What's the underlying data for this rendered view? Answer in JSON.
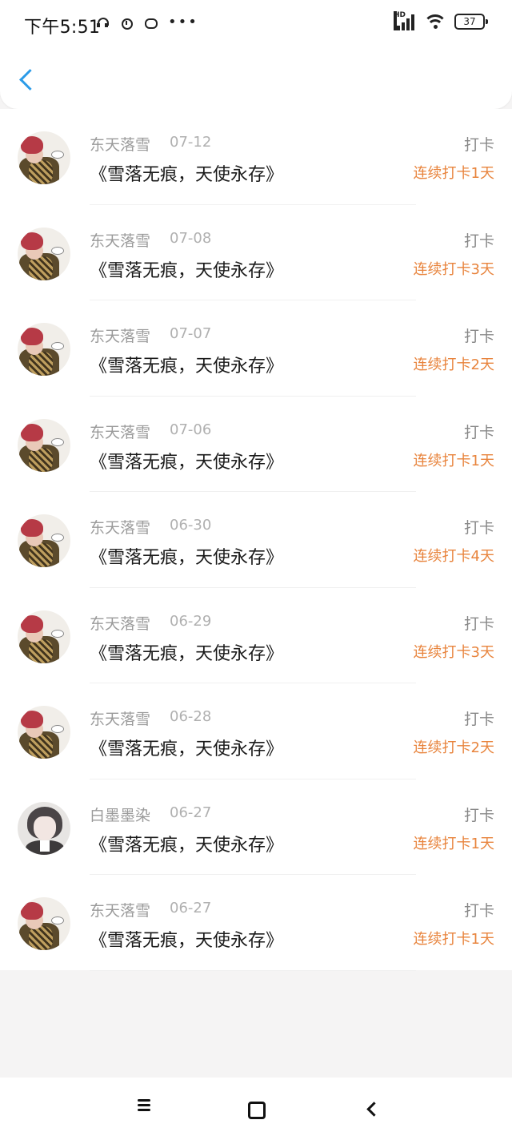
{
  "status_bar": {
    "time": "下午5:51",
    "network": "HD",
    "battery": "37",
    "icons": [
      "headset-icon",
      "timer-icon",
      "chat-icon",
      "more-dots-icon",
      "signal-icon",
      "wifi-icon",
      "battery-icon"
    ]
  },
  "header": {
    "back_icon": "chevron-left-icon",
    "accent_color": "#2b9be8"
  },
  "colors": {
    "streak": "#e8843d",
    "meta": "#9a9a9a",
    "title": "#1a1a1a"
  },
  "records": [
    {
      "user": "东天落雪",
      "date": "07-12",
      "title": "《雪落无痕，天使永存》",
      "type": "打卡",
      "streak": "连续打卡1天",
      "avatar": "avatar-a"
    },
    {
      "user": "东天落雪",
      "date": "07-08",
      "title": "《雪落无痕，天使永存》",
      "type": "打卡",
      "streak": "连续打卡3天",
      "avatar": "avatar-a"
    },
    {
      "user": "东天落雪",
      "date": "07-07",
      "title": "《雪落无痕，天使永存》",
      "type": "打卡",
      "streak": "连续打卡2天",
      "avatar": "avatar-a"
    },
    {
      "user": "东天落雪",
      "date": "07-06",
      "title": "《雪落无痕，天使永存》",
      "type": "打卡",
      "streak": "连续打卡1天",
      "avatar": "avatar-a"
    },
    {
      "user": "东天落雪",
      "date": "06-30",
      "title": "《雪落无痕，天使永存》",
      "type": "打卡",
      "streak": "连续打卡4天",
      "avatar": "avatar-a"
    },
    {
      "user": "东天落雪",
      "date": "06-29",
      "title": "《雪落无痕，天使永存》",
      "type": "打卡",
      "streak": "连续打卡3天",
      "avatar": "avatar-a"
    },
    {
      "user": "东天落雪",
      "date": "06-28",
      "title": "《雪落无痕，天使永存》",
      "type": "打卡",
      "streak": "连续打卡2天",
      "avatar": "avatar-a"
    },
    {
      "user": "白墨墨染",
      "date": "06-27",
      "title": "《雪落无痕，天使永存》",
      "type": "打卡",
      "streak": "连续打卡1天",
      "avatar": "avatar-b"
    },
    {
      "user": "东天落雪",
      "date": "06-27",
      "title": "《雪落无痕，天使永存》",
      "type": "打卡",
      "streak": "连续打卡1天",
      "avatar": "avatar-a"
    }
  ],
  "nav_bar": {
    "icons": [
      "menu-icon",
      "home-icon",
      "back-icon"
    ]
  }
}
